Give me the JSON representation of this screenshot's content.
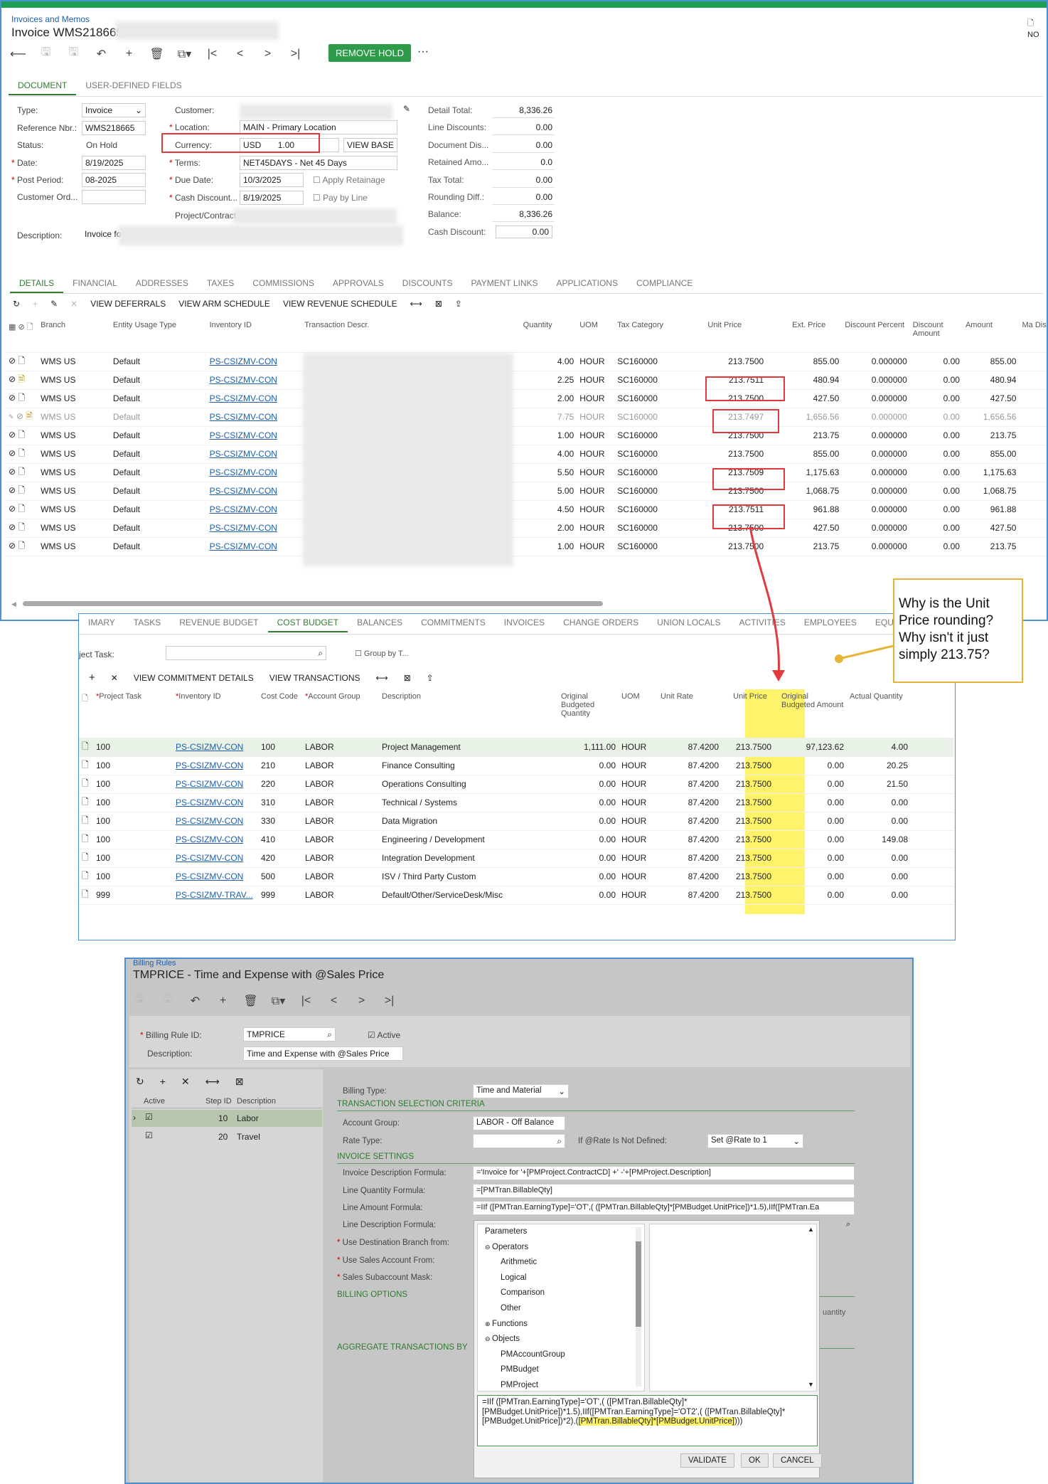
{
  "invoice": {
    "breadcrumb": "Invoices and Memos",
    "title": "Invoice WMS218665",
    "corner": "NO",
    "remove_hold": "REMOVE HOLD",
    "tabs": [
      "DOCUMENT",
      "USER-DEFINED FIELDS"
    ],
    "form": {
      "type_label": "Type:",
      "type_value": "Invoice",
      "ref_label": "Reference Nbr.:",
      "ref_value": "WMS218665",
      "status_label": "Status:",
      "status_value": "On Hold",
      "date_label": "Date:",
      "date_value": "8/19/2025",
      "post_label": "Post Period:",
      "post_value": "08-2025",
      "custord_label": "Customer Ord...",
      "desc_label": "Description:",
      "desc_value": "Invoice fo",
      "customer_label": "Customer:",
      "location_label": "Location:",
      "location_value": "MAIN - Primary Location",
      "currency_label": "Currency:",
      "currency_value": "USD",
      "currency_rate": "1.00",
      "view_base": "VIEW BASE",
      "terms_label": "Terms:",
      "terms_value": "NET45DAYS - Net 45 Days",
      "due_label": "Due Date:",
      "due_value": "10/3/2025",
      "cash_label": "Cash Discount...",
      "cash_value": "8/19/2025",
      "apply_retainage": "Apply Retainage",
      "pay_by_line": "Pay by Line",
      "project_label": "Project/Contract:"
    },
    "totals": [
      {
        "label": "Detail Total:",
        "value": "8,336.26"
      },
      {
        "label": "Line Discounts:",
        "value": "0.00"
      },
      {
        "label": "Document Dis...",
        "value": "0.00"
      },
      {
        "label": "Retained Amo...",
        "value": "0.0"
      },
      {
        "label": "Tax Total:",
        "value": "0.00"
      },
      {
        "label": "Rounding Diff.:",
        "value": "0.00"
      },
      {
        "label": "Balance:",
        "value": "8,336.26"
      },
      {
        "label": "Cash Discount:",
        "value": "0.00"
      }
    ],
    "detail_tabs": [
      "DETAILS",
      "FINANCIAL",
      "ADDRESSES",
      "TAXES",
      "COMMISSIONS",
      "APPROVALS",
      "DISCOUNTS",
      "PAYMENT LINKS",
      "APPLICATIONS",
      "COMPLIANCE"
    ],
    "grid_actions": [
      "VIEW DEFERRALS",
      "VIEW ARM SCHEDULE",
      "VIEW REVENUE SCHEDULE"
    ],
    "columns": [
      "Branch",
      "Entity Usage Type",
      "Inventory ID",
      "Transaction Descr.",
      "Quantity",
      "UOM",
      "Tax Category",
      "Unit Price",
      "Ext. Price",
      "Discount Percent",
      "Discount Amount",
      "Amount",
      "Ma Dis"
    ],
    "rows": [
      {
        "branch": "WMS US",
        "usage": "Default",
        "inv": "PS-CSIZMV-CON",
        "qty": "4.00",
        "uom": "HOUR",
        "tax": "SC160000",
        "price": "213.7500",
        "ext": "855.00",
        "dp": "0.000000",
        "da": "0.00",
        "amt": "855.00"
      },
      {
        "branch": "WMS US",
        "usage": "Default",
        "inv": "PS-CSIZMV-CON",
        "qty": "2.25",
        "uom": "HOUR",
        "tax": "SC160000",
        "price": "213.7511",
        "ext": "480.94",
        "dp": "0.000000",
        "da": "0.00",
        "amt": "480.94"
      },
      {
        "branch": "WMS US",
        "usage": "Default",
        "inv": "PS-CSIZMV-CON",
        "qty": "2.00",
        "uom": "HOUR",
        "tax": "SC160000",
        "price": "213.7500",
        "ext": "427.50",
        "dp": "0.000000",
        "da": "0.00",
        "amt": "427.50"
      },
      {
        "branch": "WMS US",
        "usage": "Default",
        "inv": "PS-CSIZMV-CON",
        "qty": "7.75",
        "uom": "HOUR",
        "tax": "SC160000",
        "price": "213.7497",
        "ext": "1,656.56",
        "dp": "0.000000",
        "da": "0.00",
        "amt": "1,656.56"
      },
      {
        "branch": "WMS US",
        "usage": "Default",
        "inv": "PS-CSIZMV-CON",
        "qty": "1.00",
        "uom": "HOUR",
        "tax": "SC160000",
        "price": "213.7500",
        "ext": "213.75",
        "dp": "0.000000",
        "da": "0.00",
        "amt": "213.75"
      },
      {
        "branch": "WMS US",
        "usage": "Default",
        "inv": "PS-CSIZMV-CON",
        "qty": "4.00",
        "uom": "HOUR",
        "tax": "SC160000",
        "price": "213.7500",
        "ext": "855.00",
        "dp": "0.000000",
        "da": "0.00",
        "amt": "855.00"
      },
      {
        "branch": "WMS US",
        "usage": "Default",
        "inv": "PS-CSIZMV-CON",
        "qty": "5.50",
        "uom": "HOUR",
        "tax": "SC160000",
        "price": "213.7509",
        "ext": "1,175.63",
        "dp": "0.000000",
        "da": "0.00",
        "amt": "1,175.63"
      },
      {
        "branch": "WMS US",
        "usage": "Default",
        "inv": "PS-CSIZMV-CON",
        "qty": "5.00",
        "uom": "HOUR",
        "tax": "SC160000",
        "price": "213.7500",
        "ext": "1,068.75",
        "dp": "0.000000",
        "da": "0.00",
        "amt": "1,068.75"
      },
      {
        "branch": "WMS US",
        "usage": "Default",
        "inv": "PS-CSIZMV-CON",
        "qty": "4.50",
        "uom": "HOUR",
        "tax": "SC160000",
        "price": "213.7511",
        "ext": "961.88",
        "dp": "0.000000",
        "da": "0.00",
        "amt": "961.88"
      },
      {
        "branch": "WMS US",
        "usage": "Default",
        "inv": "PS-CSIZMV-CON",
        "qty": "2.00",
        "uom": "HOUR",
        "tax": "SC160000",
        "price": "213.7500",
        "ext": "427.50",
        "dp": "0.000000",
        "da": "0.00",
        "amt": "427.50"
      },
      {
        "branch": "WMS US",
        "usage": "Default",
        "inv": "PS-CSIZMV-CON",
        "qty": "1.00",
        "uom": "HOUR",
        "tax": "SC160000",
        "price": "213.7500",
        "ext": "213.75",
        "dp": "0.000000",
        "da": "0.00",
        "amt": "213.75"
      }
    ]
  },
  "project": {
    "tabs": [
      "IMARY",
      "TASKS",
      "REVENUE BUDGET",
      "COST BUDGET",
      "BALANCES",
      "COMMITMENTS",
      "INVOICES",
      "CHANGE ORDERS",
      "UNION LOCALS",
      "ACTIVITIES",
      "EMPLOYEES",
      "EQU"
    ],
    "task_label": "ject Task:",
    "group_by": "Group by T...",
    "actions": [
      "VIEW COMMITMENT DETAILS",
      "VIEW TRANSACTIONS"
    ],
    "columns": [
      "Project Task",
      "Inventory ID",
      "Cost Code",
      "Account Group",
      "Description",
      "Original Budgeted Quantity",
      "UOM",
      "Unit Rate",
      "Unit Price",
      "Original Budgeted Amount",
      "Actual Quantity"
    ],
    "rows": [
      {
        "task": "100",
        "inv": "PS-CSIZMV-CON",
        "cc": "100",
        "ag": "LABOR",
        "desc": "Project Management",
        "obq": "1,111.00",
        "uom": "HOUR",
        "rate": "87.4200",
        "price": "213.7500",
        "oba": "97,123.62",
        "aq": "4.00"
      },
      {
        "task": "100",
        "inv": "PS-CSIZMV-CON",
        "cc": "210",
        "ag": "LABOR",
        "desc": "Finance Consulting",
        "obq": "0.00",
        "uom": "HOUR",
        "rate": "87.4200",
        "price": "213.7500",
        "oba": "0.00",
        "aq": "20.25"
      },
      {
        "task": "100",
        "inv": "PS-CSIZMV-CON",
        "cc": "220",
        "ag": "LABOR",
        "desc": "Operations Consulting",
        "obq": "0.00",
        "uom": "HOUR",
        "rate": "87.4200",
        "price": "213.7500",
        "oba": "0.00",
        "aq": "21.50"
      },
      {
        "task": "100",
        "inv": "PS-CSIZMV-CON",
        "cc": "310",
        "ag": "LABOR",
        "desc": "Technical / Systems",
        "obq": "0.00",
        "uom": "HOUR",
        "rate": "87.4200",
        "price": "213.7500",
        "oba": "0.00",
        "aq": "0.00"
      },
      {
        "task": "100",
        "inv": "PS-CSIZMV-CON",
        "cc": "330",
        "ag": "LABOR",
        "desc": "Data Migration",
        "obq": "0.00",
        "uom": "HOUR",
        "rate": "87.4200",
        "price": "213.7500",
        "oba": "0.00",
        "aq": "0.00"
      },
      {
        "task": "100",
        "inv": "PS-CSIZMV-CON",
        "cc": "410",
        "ag": "LABOR",
        "desc": "Engineering / Development",
        "obq": "0.00",
        "uom": "HOUR",
        "rate": "87.4200",
        "price": "213.7500",
        "oba": "0.00",
        "aq": "149.08"
      },
      {
        "task": "100",
        "inv": "PS-CSIZMV-CON",
        "cc": "420",
        "ag": "LABOR",
        "desc": "Integration Development",
        "obq": "0.00",
        "uom": "HOUR",
        "rate": "87.4200",
        "price": "213.7500",
        "oba": "0.00",
        "aq": "0.00"
      },
      {
        "task": "100",
        "inv": "PS-CSIZMV-CON",
        "cc": "500",
        "ag": "LABOR",
        "desc": "ISV / Third Party Custom",
        "obq": "0.00",
        "uom": "HOUR",
        "rate": "87.4200",
        "price": "213.7500",
        "oba": "0.00",
        "aq": "0.00"
      },
      {
        "task": "999",
        "inv": "PS-CSIZMV-TRAV...",
        "cc": "999",
        "ag": "LABOR",
        "desc": "Default/Other/ServiceDesk/Misc",
        "obq": "0.00",
        "uom": "HOUR",
        "rate": "87.4200",
        "price": "213.7500",
        "oba": "0.00",
        "aq": "0.00"
      }
    ]
  },
  "callout": "Why is the Unit Price rounding? Why isn't it just simply 213.75?",
  "billing": {
    "breadcrumb": "Billing Rules",
    "title": "TMPRICE - Time and Expense with @Sales Price",
    "rule_id_label": "Billing Rule ID:",
    "rule_id_value": "TMPRICE",
    "active_label": "Active",
    "desc_label": "Description:",
    "desc_value": "Time and Expense with @Sales Price",
    "steps_columns": [
      "Active",
      "Step ID",
      "Description"
    ],
    "steps": [
      {
        "id": "10",
        "desc": "Labor"
      },
      {
        "id": "20",
        "desc": "Travel"
      }
    ],
    "billing_type_label": "Billing Type:",
    "billing_type_value": "Time and Material",
    "sec_selection": "TRANSACTION SELECTION CRITERIA",
    "account_group_label": "Account Group:",
    "account_group_value": "LABOR - Off Balance",
    "rate_type_label": "Rate Type:",
    "if_rate_label": "If @Rate Is Not Defined:",
    "if_rate_value": "Set @Rate to 1",
    "sec_invoice": "INVOICE SETTINGS",
    "inv_desc_label": "Invoice Description Formula:",
    "inv_desc_value": "='Invoice for '+[PMProject.ContractCD] +' -'+[PMProject.Description]",
    "line_qty_label": "Line Quantity Formula:",
    "line_qty_value": "=[PMTran.BillableQty]",
    "line_amt_label": "Line Amount Formula:",
    "line_amt_value": "=IIf ([PMTran.EarningType]='OT',( ([PMTran.BillableQty]*[PMBudget.UnitPrice])*1.5),IIf([PMTran.Ea",
    "line_desc_label": "Line Description Formula:",
    "dest_branch_label": "Use Destination Branch from:",
    "sales_acct_label": "Use Sales Account From:",
    "sales_sub_label": "Sales Subaccount Mask:",
    "sec_billing": "BILLING OPTIONS",
    "sec_aggregate": "AGGREGATE TRANSACTIONS BY",
    "quantity_fragment": "uantity",
    "tree": [
      "Parameters",
      "Operators",
      "Arithmetic",
      "Logical",
      "Comparison",
      "Other",
      "Functions",
      "Objects",
      "PMAccountGroup",
      "PMBudget",
      "PMProject"
    ],
    "formula_line1": "=IIf ([PMTran.EarningType]='OT',( ([PMTran.BillableQty]*",
    "formula_line2": "[PMBudget.UnitPrice])*1.5),IIf([PMTran.EarningType]='OT2',( ([PMTran.BillableQty]*",
    "formula_line3a": "[PMBudget.UnitPrice])*2),(",
    "formula_line3b": "[PMTran.BillableQty]*[PMBudget.UnitPrice]",
    "formula_line3c": ")))",
    "validate": "VALIDATE",
    "ok": "OK",
    "cancel": "CANCEL"
  }
}
